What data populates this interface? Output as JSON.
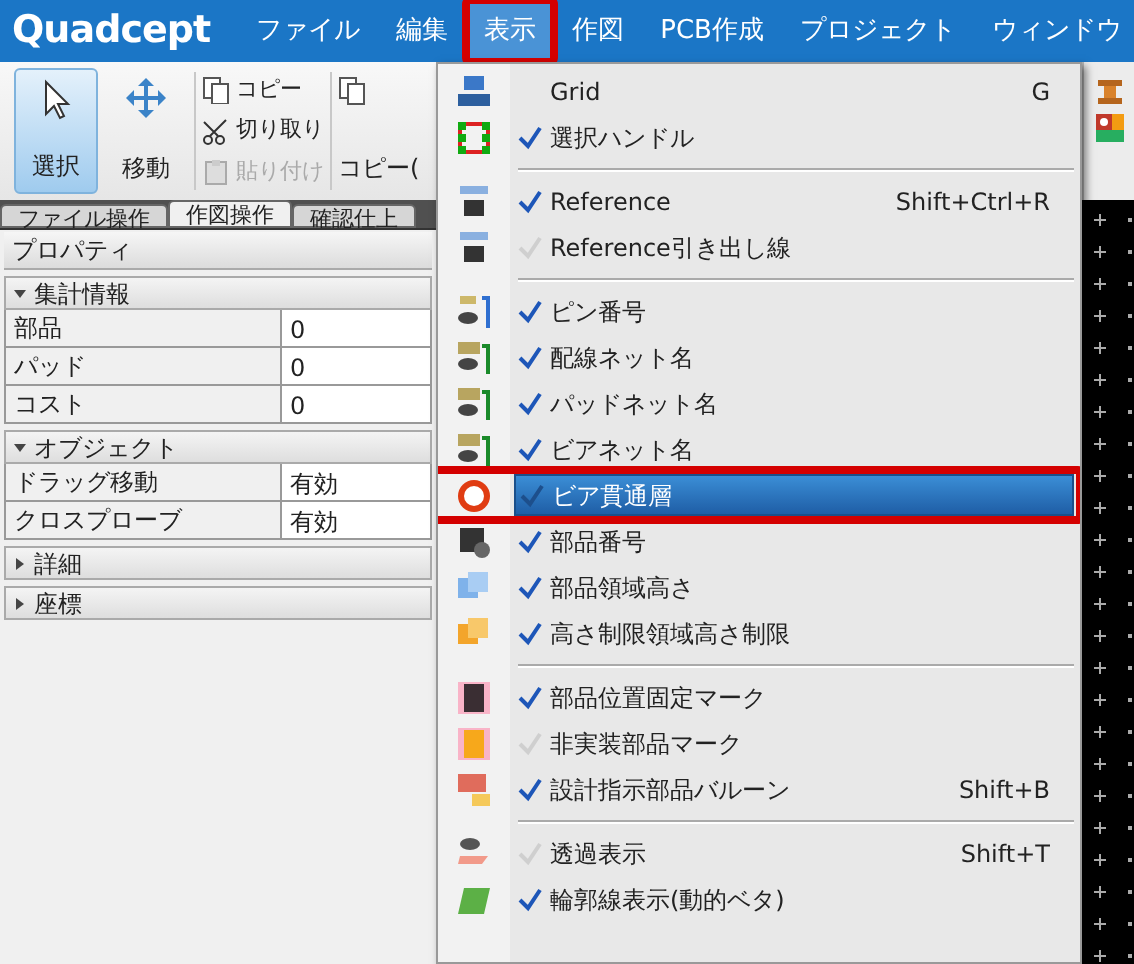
{
  "app": {
    "logo": "Quadcept"
  },
  "menu_bar": [
    {
      "label": "ファイル",
      "selected": false,
      "annotated": false
    },
    {
      "label": "編集",
      "selected": false,
      "annotated": false
    },
    {
      "label": "表示",
      "selected": true,
      "annotated": true
    },
    {
      "label": "作図",
      "selected": false,
      "annotated": false
    },
    {
      "label": "PCB作成",
      "selected": false,
      "annotated": false
    },
    {
      "label": "プロジェクト",
      "selected": false,
      "annotated": false
    },
    {
      "label": "ウィンドウ",
      "selected": false,
      "annotated": false
    }
  ],
  "ribbon": {
    "big_buttons": [
      {
        "label": "選択",
        "kind": "arrow",
        "selected": true
      },
      {
        "label": "移動",
        "kind": "move",
        "selected": false
      }
    ],
    "small_buttons": [
      {
        "label": "コピー",
        "kind": "copy",
        "disabled": false
      },
      {
        "label": "切り取り",
        "kind": "cut",
        "disabled": false
      },
      {
        "label": "貼り付け",
        "kind": "paste",
        "disabled": true
      }
    ],
    "cut_button": {
      "label": "コピー("
    },
    "tabs": [
      {
        "label": "ファイル操作",
        "selected": false
      },
      {
        "label": "作図操作",
        "selected": true
      },
      {
        "label": "確認仕上",
        "selected": false
      }
    ]
  },
  "properties": {
    "title": "プロパティ",
    "sections": [
      {
        "title": "集計情報",
        "expanded": true,
        "rows": [
          {
            "name": "部品",
            "value": "0"
          },
          {
            "name": "パッド",
            "value": "0"
          },
          {
            "name": "コスト",
            "value": "0"
          }
        ]
      },
      {
        "title": "オブジェクト",
        "expanded": true,
        "rows": [
          {
            "name": "ドラッグ移動",
            "value": "有効"
          },
          {
            "name": "クロスプローブ",
            "value": "有効"
          }
        ]
      },
      {
        "title": "詳細",
        "expanded": false
      },
      {
        "title": "座標",
        "expanded": false
      }
    ]
  },
  "view_menu": [
    {
      "kind": "item",
      "label": "Grid",
      "shortcut": "G",
      "selected": false
    },
    {
      "kind": "item",
      "label": "選択ハンドル",
      "checked": true,
      "selected": false
    },
    {
      "kind": "separator"
    },
    {
      "kind": "item",
      "label": "Reference",
      "shortcut": "Shift+Ctrl+R",
      "checked": true,
      "selected": false
    },
    {
      "kind": "item",
      "label": "Reference引き出し線",
      "checked": false,
      "selected": false
    },
    {
      "kind": "separator"
    },
    {
      "kind": "item",
      "label": "ピン番号",
      "checked": true,
      "selected": false
    },
    {
      "kind": "item",
      "label": "配線ネット名",
      "checked": true,
      "selected": false
    },
    {
      "kind": "item",
      "label": "パッドネット名",
      "checked": true,
      "selected": false
    },
    {
      "kind": "item",
      "label": "ビアネット名",
      "checked": true,
      "selected": false
    },
    {
      "kind": "item",
      "label": "ビア貫通層",
      "checked": true,
      "selected": true,
      "annotated": true
    },
    {
      "kind": "item",
      "label": "部品番号",
      "checked": true,
      "selected": false
    },
    {
      "kind": "item",
      "label": "部品領域高さ",
      "checked": true,
      "selected": false
    },
    {
      "kind": "item",
      "label": "高さ制限領域高さ制限",
      "checked": true,
      "selected": false
    },
    {
      "kind": "separator"
    },
    {
      "kind": "item",
      "label": "部品位置固定マーク",
      "checked": true,
      "selected": false
    },
    {
      "kind": "item",
      "label": "非実装部品マーク",
      "checked": false,
      "selected": false
    },
    {
      "kind": "item",
      "label": "設計指示部品バルーン",
      "shortcut": "Shift+B",
      "checked": true,
      "selected": false
    },
    {
      "kind": "separator"
    },
    {
      "kind": "item",
      "label": "透過表示",
      "shortcut": "Shift+T",
      "checked": false,
      "selected": false
    },
    {
      "kind": "item",
      "label": "輪郭線表示(動的ベタ)",
      "checked": true,
      "selected": false
    }
  ]
}
